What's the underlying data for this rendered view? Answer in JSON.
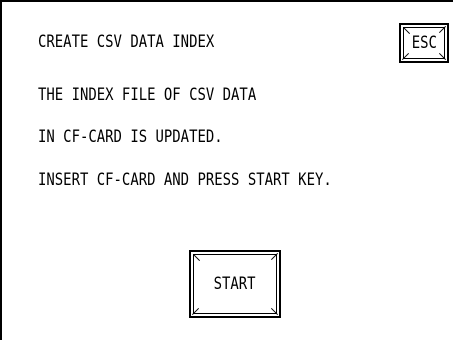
{
  "screen": {
    "title": "CREATE CSV DATA INDEX",
    "message_lines": [
      "THE INDEX FILE OF CSV DATA",
      "IN CF-CARD IS UPDATED.",
      "INSERT CF-CARD AND PRESS START KEY."
    ]
  },
  "buttons": {
    "esc_label": "ESC",
    "start_label": "START"
  },
  "colors": {
    "background": "#ffffff",
    "foreground": "#000000"
  }
}
